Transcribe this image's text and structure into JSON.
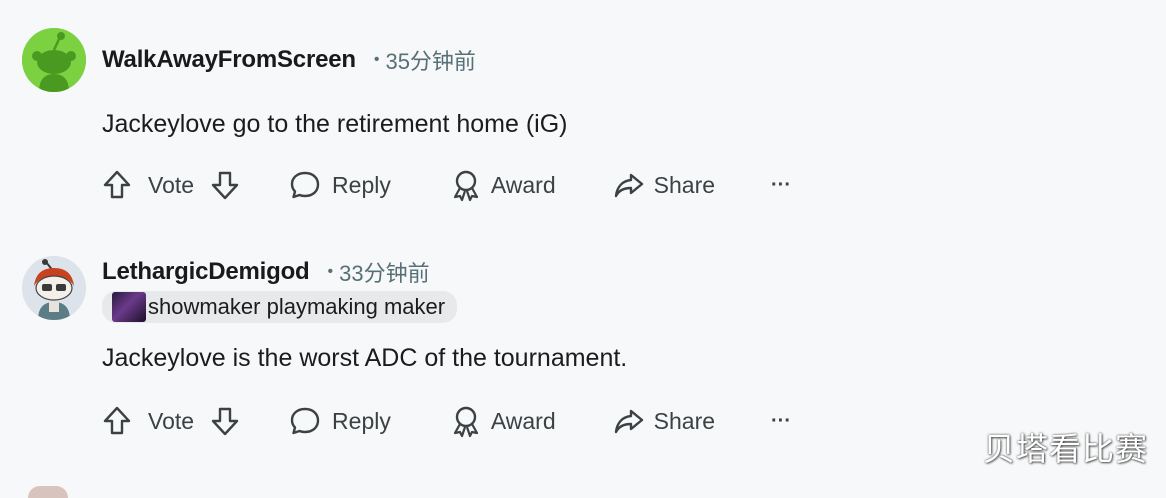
{
  "comments": [
    {
      "username": "WalkAwayFromScreen",
      "separator": "•",
      "time": "35分钟前",
      "body": "Jackeylove go to the retirement home (iG)",
      "avatar_icon": "snoo-green-avatar",
      "actions": {
        "vote_label": "Vote",
        "reply_label": "Reply",
        "award_label": "Award",
        "share_label": "Share",
        "more_label": "···"
      }
    },
    {
      "username": "LethargicDemigod",
      "separator": "•",
      "time": "33分钟前",
      "flair": "showmaker playmaking maker",
      "body": "Jackeylove is the worst ADC of the tournament.",
      "avatar_icon": "snoo-red-hair-avatar",
      "actions": {
        "vote_label": "Vote",
        "reply_label": "Reply",
        "award_label": "Award",
        "share_label": "Share",
        "more_label": "···"
      }
    }
  ],
  "watermark": "贝塔看比赛",
  "colors": {
    "background": "#f7f8f9",
    "meta_text": "#576f76",
    "action_text": "#3c4144",
    "flair_bg": "#e7e9eb"
  }
}
